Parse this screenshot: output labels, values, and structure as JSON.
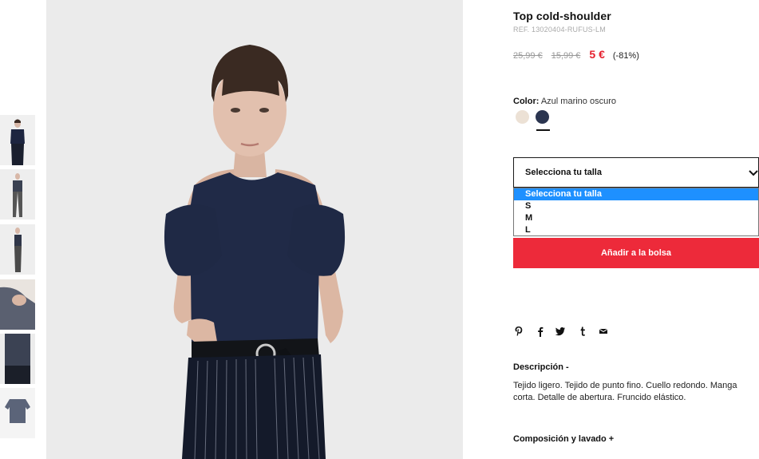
{
  "product": {
    "title": "Top cold-shoulder",
    "ref": "REF. 13020404-RUFUS-LM",
    "price_original": "25,99 €",
    "price_previous": "15,99 €",
    "price_current": "5 €",
    "discount": "(-81%)"
  },
  "color": {
    "label": "Color:",
    "selected_name": "Azul marino oscuro",
    "swatches": [
      {
        "name": "beige",
        "hex": "#ece1d5"
      },
      {
        "name": "navy",
        "hex": "#2b3550",
        "selected": true
      }
    ]
  },
  "size": {
    "select_label": "Selecciona tu talla",
    "options": [
      "Selecciona tu talla",
      "S",
      "M",
      "L"
    ],
    "highlighted_option": "Selecciona tu talla"
  },
  "cart": {
    "add_label": "Añadir a la bolsa"
  },
  "share": {
    "icons": [
      "pinterest-icon",
      "facebook-icon",
      "twitter-icon",
      "tumblr-icon",
      "mail-icon"
    ]
  },
  "description": {
    "title": "Descripción -",
    "body": "Tejido ligero. Tejido de punto fino. Cuello redondo. Manga corta. Detalle de abertura. Fruncido elástico."
  },
  "composition": {
    "title": "Composición y lavado +"
  },
  "gallery": {
    "thumbnail_count": 6
  },
  "colors": {
    "accent_red": "#ed2a3a",
    "price_red": "#e5202e",
    "dropdown_highlight": "#1e90ff"
  }
}
